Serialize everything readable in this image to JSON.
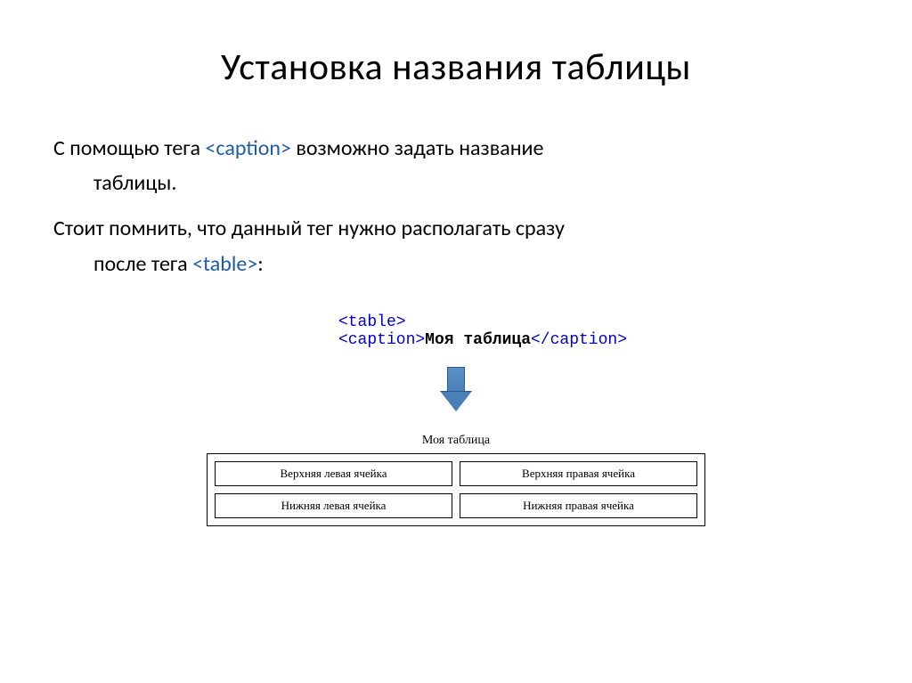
{
  "title": "Установка названия таблицы",
  "paragraph1": {
    "prefix": "С помощью тега ",
    "tag": "<caption>",
    "suffix": "  возможно задать название",
    "line2": "таблицы."
  },
  "paragraph2": {
    "line1": "Стоит помнить, что данный тег нужно располагать сразу",
    "line2_prefix": "после тега ",
    "line2_tag": "<table>",
    "line2_suffix": ":"
  },
  "code": {
    "table_open": "<table>",
    "caption_open": "<caption>",
    "caption_text": "Моя таблица",
    "caption_close": "</caption>"
  },
  "output": {
    "caption": "Моя таблица",
    "cells": {
      "r1c1": "Верхняя левая ячейка",
      "r1c2": "Верхняя правая ячейка",
      "r2c1": "Нижняя левая ячейка",
      "r2c2": "Нижняя правая ячейка"
    }
  }
}
